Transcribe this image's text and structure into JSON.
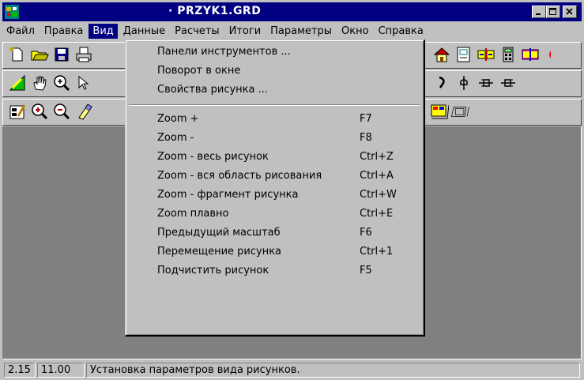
{
  "window": {
    "title": "PRZYK1.GRD",
    "title_prefix": "·"
  },
  "menubar": [
    {
      "label": "Файл",
      "active": false
    },
    {
      "label": "Правка",
      "active": false
    },
    {
      "label": "Вид",
      "active": true
    },
    {
      "label": "Данные",
      "active": false
    },
    {
      "label": "Расчеты",
      "active": false
    },
    {
      "label": "Итоги",
      "active": false
    },
    {
      "label": "Параметры",
      "active": false
    },
    {
      "label": "Окно",
      "active": false
    },
    {
      "label": "Справка",
      "active": false
    }
  ],
  "view_menu": {
    "group1": [
      {
        "label": "Панели инструментов ..."
      },
      {
        "label": "Поворот в окне"
      },
      {
        "label": "Свойства рисунка ..."
      }
    ],
    "group2": [
      {
        "label": "Zoom +",
        "shortcut": "F7"
      },
      {
        "label": "Zoom -",
        "shortcut": "F8"
      },
      {
        "label": "Zoom - весь рисунок",
        "shortcut": "Ctrl+Z"
      },
      {
        "label": "Zoom - вся область рисования",
        "shortcut": "Ctrl+A"
      },
      {
        "label": "Zoom - фрагмент рисунка",
        "shortcut": "Ctrl+W"
      },
      {
        "label": "Zoom плавно",
        "shortcut": "Ctrl+E"
      },
      {
        "label": "Предыдущий масштаб",
        "shortcut": "F6"
      },
      {
        "label": "Перемещение рисунка",
        "shortcut": "Ctrl+1"
      },
      {
        "label": "Подчистить рисунок",
        "shortcut": "F5"
      }
    ]
  },
  "statusbar": {
    "coord_a": "2.15",
    "coord_b": "11.00",
    "message": "Установка параметров вида рисунков."
  },
  "icons": {
    "toolbar1_left": [
      "new-file-icon",
      "open-folder-icon",
      "save-disk-icon",
      "print-icon"
    ],
    "toolbar1_right": [
      "house-icon",
      "frame-icon",
      "grid-toggle-icon",
      "calculator-icon",
      "grid-toggle-alt-icon"
    ],
    "toolbar2_left": [
      "edit-draw-icon",
      "hand-pan-icon",
      "zoom-plus-icon",
      "pointer-icon"
    ],
    "toolbar2_right": [
      "hook-icon",
      "pin-icon",
      "plug-left-icon",
      "plug-right-icon"
    ],
    "toolbar3_left": [
      "properties-icon",
      "zoom-in-icon",
      "zoom-out-icon",
      "eraser-icon"
    ],
    "toolbar3_right": [
      "table-tab-icon",
      "frame-tab-icon"
    ]
  },
  "colors": {
    "titlebar": "#000080",
    "menu_highlight": "#000080",
    "workspace": "#808080",
    "chrome": "#c0c0c0"
  }
}
